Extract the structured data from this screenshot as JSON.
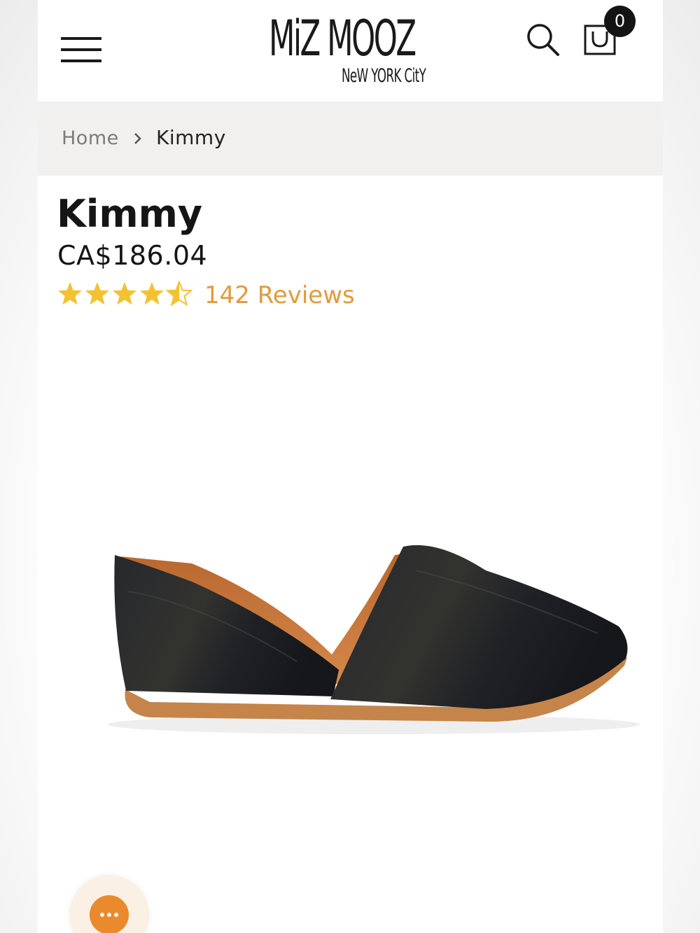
{
  "header": {
    "logo_main": "MiZ MOOZ",
    "logo_sub": "NeW YORK CitY",
    "cart_count": "0",
    "icons": {
      "menu": "hamburger-menu-icon",
      "search": "search-icon",
      "cart": "shopping-bag-icon"
    }
  },
  "breadcrumb": {
    "home": "Home",
    "current": "Kimmy"
  },
  "product": {
    "title": "Kimmy",
    "price": "CA$186.04",
    "rating": 4.5,
    "rating_max": 5,
    "reviews_label": "142 Reviews"
  },
  "chat": {
    "icon": "chat-dots-icon"
  },
  "colors": {
    "star": "#f2c232",
    "reviews_link": "#e39a3c",
    "chat_button": "#ea8a2c",
    "breadcrumb_bg": "#f1f0ef"
  }
}
